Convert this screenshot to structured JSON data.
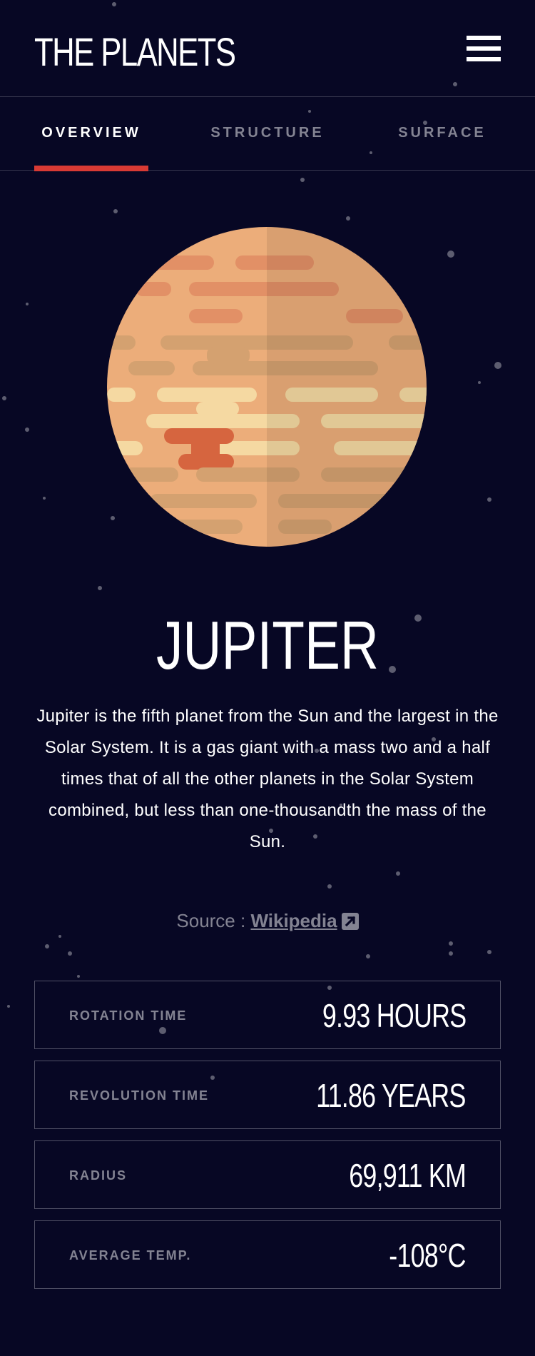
{
  "header": {
    "logo": "THE PLANETS",
    "menu_icon": "hamburger-menu-icon"
  },
  "tabs": [
    {
      "label": "OVERVIEW",
      "active": true
    },
    {
      "label": "STRUCTURE",
      "active": false
    },
    {
      "label": "SURFACE",
      "active": false
    }
  ],
  "planet": {
    "name": "JUPITER",
    "description": "Jupiter is the fifth planet from the Sun and the largest in the Solar System. It is a gas giant with a mass two and a half times that of all the other planets in the Solar System combined, but less than one-thousandth the mass of the Sun.",
    "source_prefix": "Source : ",
    "source_link": "Wikipedia",
    "source_icon": "external-link-icon"
  },
  "stats": [
    {
      "label": "ROTATION TIME",
      "value": "9.93 HOURS"
    },
    {
      "label": "REVOLUTION TIME",
      "value": "11.86 YEARS"
    },
    {
      "label": "RADIUS",
      "value": "69,911 KM"
    },
    {
      "label": "AVERAGE TEMP.",
      "value": "-108°C"
    }
  ],
  "colors": {
    "background": "#070724",
    "accent": "#D83A34",
    "planet": "#ECAD7A"
  }
}
